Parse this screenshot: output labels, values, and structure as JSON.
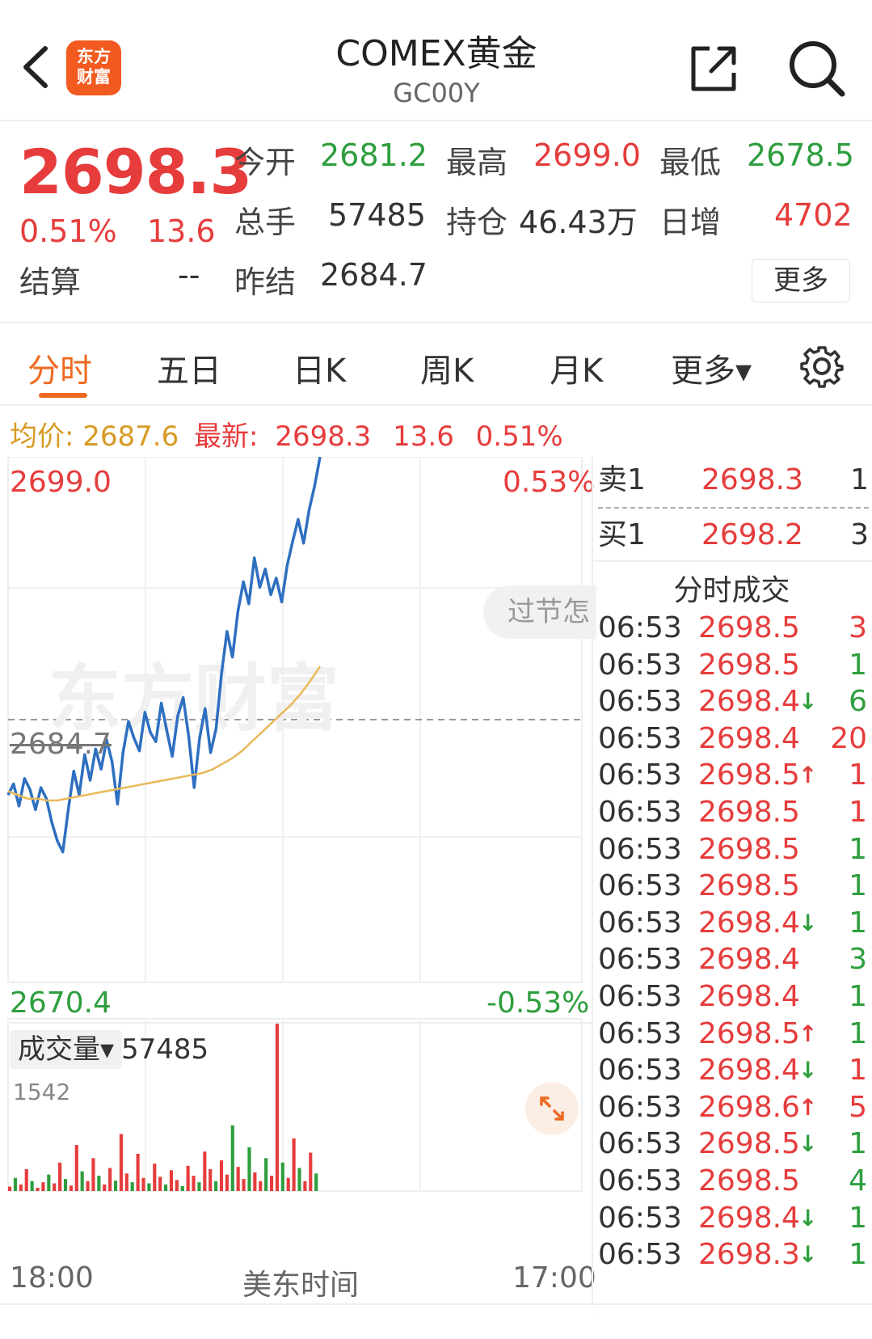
{
  "header": {
    "title": "COMEX黄金",
    "code": "GC00Y",
    "logo_text": [
      "东方",
      "财富"
    ]
  },
  "quote": {
    "price": "2698.3",
    "change_pct": "0.51%",
    "change": "13.6",
    "open_label": "今开",
    "open": "2681.2",
    "high_label": "最高",
    "high": "2699.0",
    "low_label": "最低",
    "low": "2678.5",
    "volume_label": "总手",
    "volume": "57485",
    "oi_label": "持仓",
    "oi": "46.43万",
    "daily_inc_label": "日增",
    "daily_inc": "4702",
    "settle_label": "结算",
    "settle": "--",
    "prev_settle_label": "昨结",
    "prev_settle": "2684.7",
    "more_label": "更多"
  },
  "tabs": [
    {
      "label": "分时"
    },
    {
      "label": "五日"
    },
    {
      "label": "日K"
    },
    {
      "label": "周K"
    },
    {
      "label": "月K"
    },
    {
      "label": "更多▾"
    }
  ],
  "avg_line": {
    "avg_label": "均价:",
    "avg": "2687.6",
    "last_label": "最新:",
    "last": "2698.3",
    "chg": "13.6",
    "pct": "0.51%"
  },
  "chart": {
    "ymax": "2699.0",
    "ymin": "2670.4",
    "pct_max": "0.53%",
    "pct_min": "-0.53%",
    "ref": "2684.7",
    "promo": "过节怎",
    "watermark": "东方财富",
    "time_start": "18:00",
    "time_mid": "美东时间",
    "time_end": "17:00",
    "colors": {
      "price": "#2e6fc0",
      "avg": "#e8b95a",
      "up": "#e63c3c",
      "down": "#2e9e3e"
    }
  },
  "volume": {
    "selector_label": "成交量▾",
    "value": "57485",
    "max_label": "1542"
  },
  "chart_data": {
    "type": "line",
    "title": "",
    "xlabel": "美东时间",
    "ylabel": "",
    "ylim": [
      2670.4,
      2699.0
    ],
    "reference": 2684.7,
    "x_ticks": [
      "18:00",
      "17:00"
    ],
    "series": [
      {
        "name": "",
        "values": [
          2680.6,
          2681.2,
          2680.0,
          2681.5,
          2680.9,
          2679.8,
          2681.0,
          2680.4,
          2679.1,
          2678.1,
          2677.5,
          2679.8,
          2681.9,
          2680.6,
          2682.8,
          2681.4,
          2683.1,
          2682.0,
          2683.6,
          2682.4,
          2680.1,
          2682.9,
          2684.6,
          2683.7,
          2683.0,
          2685.1,
          2684.0,
          2683.5,
          2685.6,
          2684.1,
          2682.7,
          2684.9,
          2685.9,
          2683.8,
          2681.0,
          2683.7,
          2685.3,
          2682.9,
          2684.2,
          2687.2,
          2689.5,
          2688.1,
          2690.6,
          2692.2,
          2691.0,
          2693.5,
          2691.9,
          2692.9,
          2691.5,
          2692.4,
          2691.1,
          2693.1,
          2694.4,
          2695.6,
          2694.3,
          2696.1,
          2697.4,
          2699.0
        ]
      },
      {
        "name": "",
        "values": [
          2680.8,
          2680.6,
          2680.4,
          2680.4,
          2680.3,
          2680.3,
          2680.4,
          2680.5,
          2680.6,
          2680.7,
          2680.8,
          2680.9,
          2681.0,
          2681.1,
          2681.2,
          2681.3,
          2681.4,
          2681.5,
          2681.6,
          2681.7,
          2681.8,
          2682.0,
          2682.3,
          2682.6,
          2683.0,
          2683.5,
          2684.0,
          2684.5,
          2685.0,
          2685.5,
          2686.1,
          2686.8,
          2687.6
        ]
      }
    ],
    "volume_max": 1542,
    "volume": [
      40,
      120,
      60,
      200,
      90,
      30,
      80,
      150,
      70,
      260,
      110,
      50,
      420,
      180,
      90,
      300,
      140,
      60,
      210,
      95,
      520,
      160,
      80,
      340,
      120,
      70,
      250,
      130,
      60,
      190,
      100,
      45,
      230,
      140,
      80,
      360,
      200,
      90,
      280,
      150,
      600,
      220,
      110,
      400,
      170,
      90,
      300,
      140,
      1542,
      260,
      120,
      480,
      210,
      90,
      350,
      160
    ]
  },
  "orderbook": {
    "ask": {
      "label": "卖1",
      "price": "2698.3",
      "qty": "1"
    },
    "bid": {
      "label": "买1",
      "price": "2698.2",
      "qty": "3"
    },
    "trades_title": "分时成交",
    "trades": [
      {
        "time": "06:53",
        "price": "2698.5",
        "arrow": "",
        "qty": "3",
        "qcolor": "red"
      },
      {
        "time": "06:53",
        "price": "2698.5",
        "arrow": "",
        "qty": "1",
        "qcolor": "green"
      },
      {
        "time": "06:53",
        "price": "2698.4",
        "arrow": "↓",
        "qty": "6",
        "qcolor": "green"
      },
      {
        "time": "06:53",
        "price": "2698.4",
        "arrow": "",
        "qty": "20",
        "qcolor": "red"
      },
      {
        "time": "06:53",
        "price": "2698.5",
        "arrow": "↑",
        "qty": "1",
        "qcolor": "red"
      },
      {
        "time": "06:53",
        "price": "2698.5",
        "arrow": "",
        "qty": "1",
        "qcolor": "red"
      },
      {
        "time": "06:53",
        "price": "2698.5",
        "arrow": "",
        "qty": "1",
        "qcolor": "green"
      },
      {
        "time": "06:53",
        "price": "2698.5",
        "arrow": "",
        "qty": "1",
        "qcolor": "green"
      },
      {
        "time": "06:53",
        "price": "2698.4",
        "arrow": "↓",
        "qty": "1",
        "qcolor": "green"
      },
      {
        "time": "06:53",
        "price": "2698.4",
        "arrow": "",
        "qty": "3",
        "qcolor": "green"
      },
      {
        "time": "06:53",
        "price": "2698.4",
        "arrow": "",
        "qty": "1",
        "qcolor": "green"
      },
      {
        "time": "06:53",
        "price": "2698.5",
        "arrow": "↑",
        "qty": "1",
        "qcolor": "green"
      },
      {
        "time": "06:53",
        "price": "2698.4",
        "arrow": "↓",
        "qty": "1",
        "qcolor": "red"
      },
      {
        "time": "06:53",
        "price": "2698.6",
        "arrow": "↑",
        "qty": "5",
        "qcolor": "red"
      },
      {
        "time": "06:53",
        "price": "2698.5",
        "arrow": "↓",
        "qty": "1",
        "qcolor": "green"
      },
      {
        "time": "06:53",
        "price": "2698.5",
        "arrow": "",
        "qty": "4",
        "qcolor": "green"
      },
      {
        "time": "06:53",
        "price": "2698.4",
        "arrow": "↓",
        "qty": "1",
        "qcolor": "green"
      },
      {
        "time": "06:53",
        "price": "2698.3",
        "arrow": "↓",
        "qty": "1",
        "qcolor": "green"
      }
    ]
  }
}
